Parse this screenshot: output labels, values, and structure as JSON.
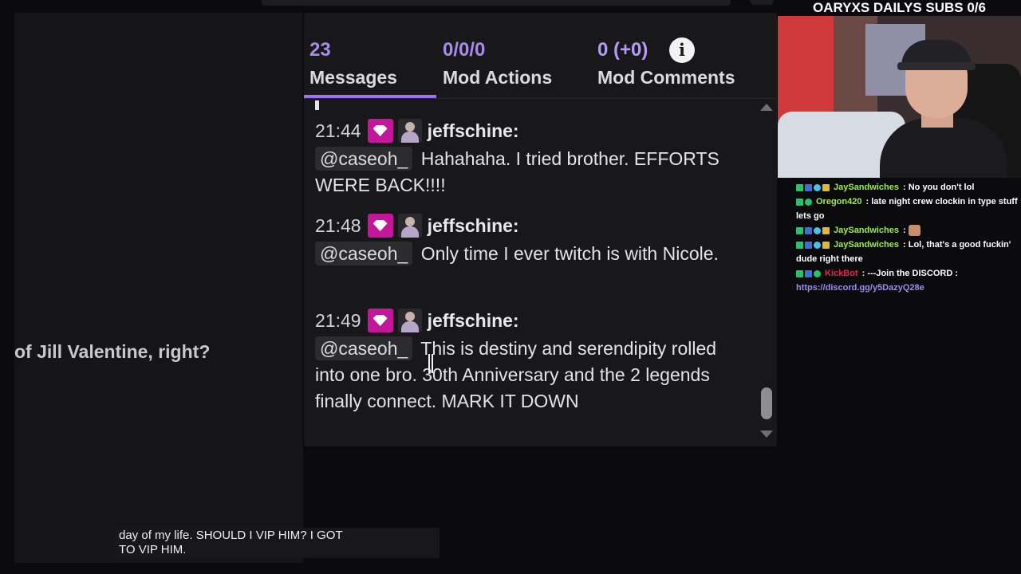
{
  "stream": {
    "header": "OARYXS DAILYS SUBS 0/6",
    "left_caption": "of Jill Valentine, right?",
    "subtitle_lines": [
      "day of my life. SHOULD I VIP HIM? I GOT",
      "TO VIP HIM."
    ]
  },
  "viewer_card": {
    "tabs": [
      {
        "count": "23",
        "label": "Messages",
        "active": true
      },
      {
        "count": "0/0/0",
        "label": "Mod Actions",
        "active": false
      },
      {
        "count": "0 (+0)",
        "label": "Mod Comments",
        "active": false
      }
    ],
    "info_icon": "i",
    "accent_color": "#9b72f5",
    "messages": [
      {
        "time": "21:44",
        "user": "jeffschine:",
        "mention": "@caseoh_",
        "text": "Hahahaha. I tried brother. EFFORTS WERE BACK!!!!"
      },
      {
        "time": "21:48",
        "user": "jeffschine:",
        "mention": "@caseoh_",
        "text": "Only time I ever twitch is with Nicole."
      },
      {
        "time": "21:49",
        "user": "jeffschine:",
        "mention": "@caseoh_",
        "text": "This is destiny and serendipity rolled into one bro. 30th Anniversary and the 2 legends finally connect. MARK IT DOWN"
      }
    ],
    "badges": [
      "gem-badge",
      "avatar-badge"
    ]
  },
  "stream_chat": [
    {
      "user": "JaySandwiches",
      "user_color": "#9bef3f",
      "sep": " : ",
      "text": "No you don't lol",
      "icons": [
        "k",
        "b",
        "c",
        "y"
      ]
    },
    {
      "user": "Oregon420",
      "user_color": "#9bef3f",
      "sep": " : ",
      "text": "late night crew clockin in type stuff lets go",
      "icons": [
        "k",
        "g"
      ]
    },
    {
      "user": "JaySandwiches",
      "user_color": "#9bef3f",
      "sep": " : ",
      "text": "",
      "emote": true,
      "icons": [
        "k",
        "b",
        "c",
        "y"
      ]
    },
    {
      "user": "JaySandwiches",
      "user_color": "#9bef3f",
      "sep": " : ",
      "text": "Lol, that's a good fuckin' dude right there",
      "icons": [
        "k",
        "b",
        "c",
        "y"
      ]
    },
    {
      "user": "KickBot",
      "user_color": "#e0264a",
      "sep": " : ",
      "text": "---Join the DISCORD :",
      "link": "https://discord.gg/y5DazyQ28e",
      "icons": [
        "k",
        "b",
        "g"
      ]
    }
  ]
}
